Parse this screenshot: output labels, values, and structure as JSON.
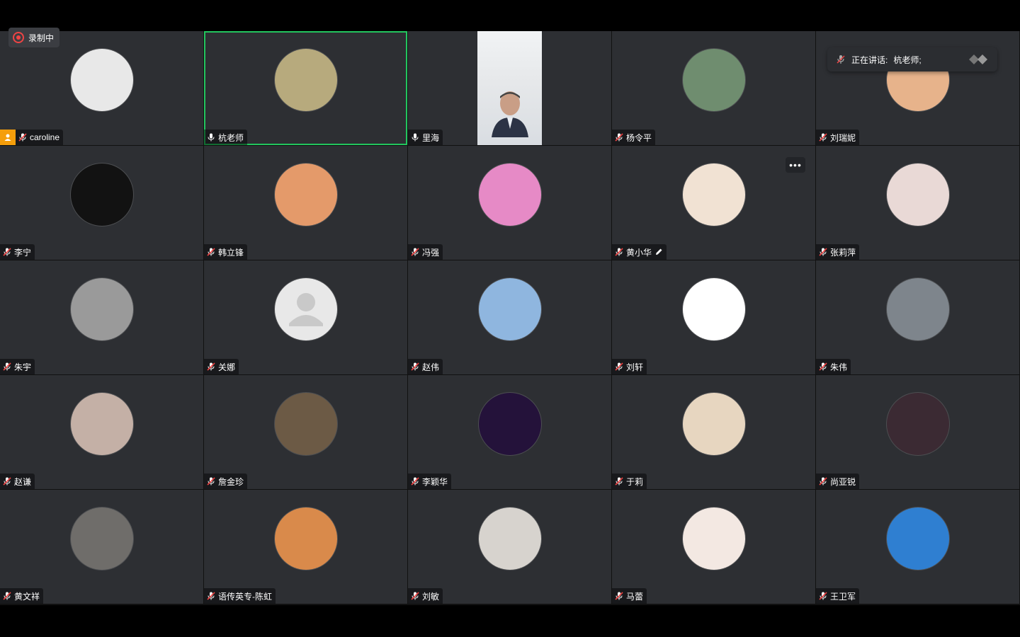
{
  "recording": {
    "label": "录制中"
  },
  "speaking": {
    "prefix": "正在讲话:",
    "names": "杭老师;"
  },
  "participants": [
    {
      "name": "caroline",
      "mic": "muted",
      "host": true,
      "avatar_icon": "cartoon-portrait-icon",
      "avatar_color": "#e8e8e8"
    },
    {
      "name": "杭老师",
      "mic": "on",
      "active": true,
      "avatar_icon": "orchid-painting-icon",
      "avatar_color": "#b7aa7d"
    },
    {
      "name": "里海",
      "mic": "on",
      "video": true
    },
    {
      "name": "杨令平",
      "mic": "muted",
      "avatar_icon": "waterfall-photo-icon",
      "avatar_color": "#6f8d6f"
    },
    {
      "name": "刘瑞妮",
      "mic": "muted",
      "avatar_icon": "hot-air-balloon-icon",
      "avatar_color": "#e7b38b"
    },
    {
      "name": "李宁",
      "mic": "muted",
      "avatar_icon": "calligraphy-icon",
      "avatar_color": "#121212"
    },
    {
      "name": "韩立锋",
      "mic": "muted",
      "avatar_icon": "pavilion-sunset-icon",
      "avatar_color": "#e49a6a"
    },
    {
      "name": "冯强",
      "mic": "muted",
      "avatar_icon": "pink-object-icon",
      "avatar_color": "#e68ac6"
    },
    {
      "name": "黄小华",
      "mic": "muted",
      "more": true,
      "edit": true,
      "avatar_icon": "cartoon-girl-icon",
      "avatar_color": "#f1e2d3"
    },
    {
      "name": "张莉萍",
      "mic": "muted",
      "avatar_icon": "flower-basket-icon",
      "avatar_color": "#e9d9d6"
    },
    {
      "name": "朱宇",
      "mic": "muted",
      "avatar_icon": "bw-portrait-icon",
      "avatar_color": "#9a9a9a"
    },
    {
      "name": "关娜",
      "mic": "muted",
      "avatar_icon": "default-user-icon",
      "avatar_color": "#e8e8e8"
    },
    {
      "name": "赵伟",
      "mic": "muted",
      "avatar_icon": "sky-photo-icon",
      "avatar_color": "#8fb6df"
    },
    {
      "name": "刘轩",
      "mic": "muted",
      "avatar_icon": "tiger-cartoon-icon",
      "avatar_color": "#ffffff"
    },
    {
      "name": "朱伟",
      "mic": "muted",
      "avatar_icon": "landscape-bw-icon",
      "avatar_color": "#7e858c"
    },
    {
      "name": "赵谦",
      "mic": "muted",
      "avatar_icon": "smiling-woman-icon",
      "avatar_color": "#c4b0a6"
    },
    {
      "name": "詹金珍",
      "mic": "muted",
      "avatar_icon": "man-portrait-icon",
      "avatar_color": "#6c5a45"
    },
    {
      "name": "李颖华",
      "mic": "muted",
      "avatar_icon": "opera-mask-icon",
      "avatar_color": "#24123a"
    },
    {
      "name": "于莉",
      "mic": "muted",
      "avatar_icon": "cartoon-child-icon",
      "avatar_color": "#e7d6c0"
    },
    {
      "name": "尚亚锐",
      "mic": "muted",
      "avatar_icon": "flower-tree-icon",
      "avatar_color": "#3b2a33"
    },
    {
      "name": "黄文祥",
      "mic": "muted",
      "avatar_icon": "young-man-icon",
      "avatar_color": "#6f6d6a"
    },
    {
      "name": "语传英专-陈虹",
      "mic": "muted",
      "avatar_icon": "beach-photo-icon",
      "avatar_color": "#d98a4b"
    },
    {
      "name": "刘敏",
      "mic": "muted",
      "avatar_icon": "sketch-girl-icon",
      "avatar_color": "#d7d3ce"
    },
    {
      "name": "马蕾",
      "mic": "muted",
      "avatar_icon": "snow-white-icon",
      "avatar_color": "#f3e8e2"
    },
    {
      "name": "王卫军",
      "mic": "muted",
      "avatar_icon": "sailboat-icon",
      "avatar_color": "#2f7fd1"
    }
  ]
}
